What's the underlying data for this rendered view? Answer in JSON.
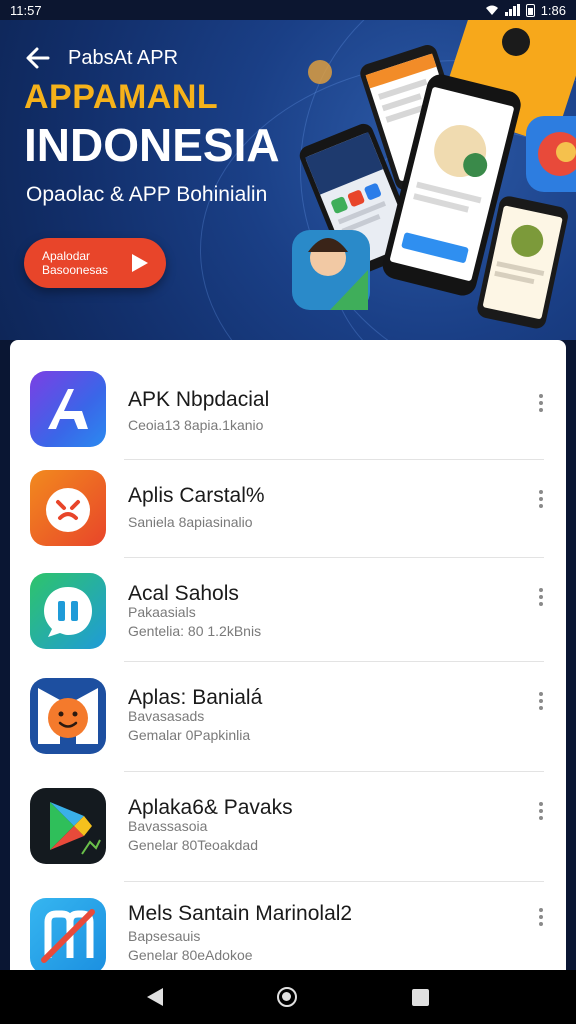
{
  "status_bar": {
    "time": "11:57",
    "battery": "1:86"
  },
  "banner": {
    "top_label": "PabsAt APR",
    "title_line1": "APPAMANL",
    "title_line2": "INDONESIA",
    "subtitle": "Opaolac & APP Bohinialin",
    "cta_label": "Apalodar Basoonesas",
    "colors": {
      "title_accent": "#f6b21a",
      "cta": "#e8452a",
      "background": "#1a3f86"
    }
  },
  "apps": [
    {
      "name": "APK Nbpdacial",
      "meta_lines": [
        "Ceoia13 8apia.1kanio"
      ],
      "icon": "stylized-a-icon"
    },
    {
      "name": "Aplis Carstal%",
      "meta_lines": [
        "Saniela 8apiasinalio"
      ],
      "icon": "smile-burst-icon"
    },
    {
      "name": "Acal Sahols",
      "meta_lines": [
        "Pakaasials",
        "Gentelia: 80 1.2kBnis"
      ],
      "icon": "chat-bubble-icon"
    },
    {
      "name": "Aplas: Banialá",
      "meta_lines": [
        "Bavasasads",
        "Gemalar 0Papkinlia"
      ],
      "icon": "smiley-face-icon"
    },
    {
      "name": "Aplaka6& Pavaks",
      "meta_lines": [
        "Bavassasoia",
        "Genelar 80Teoakdad"
      ],
      "icon": "play-triangle-icon"
    },
    {
      "name": "Mels Santain Marinolal2",
      "meta_lines": [
        "Bapsesauis",
        "Genelar 80eAdokoe"
      ],
      "icon": "slashed-n-icon"
    }
  ]
}
